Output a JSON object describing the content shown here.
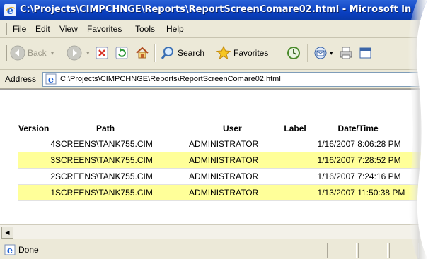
{
  "window": {
    "title": "C:\\Projects\\CIMPCHNGE\\Reports\\ReportScreenComare02.html - Microsoft In"
  },
  "menu": {
    "items": [
      "File",
      "Edit",
      "View",
      "Favorites",
      "Tools",
      "Help"
    ]
  },
  "toolbar": {
    "back_label": "Back",
    "search_label": "Search",
    "favorites_label": "Favorites"
  },
  "address": {
    "label": "Address",
    "value": "C:\\Projects\\CIMPCHNGE\\Reports\\ReportScreenComare02.html"
  },
  "report": {
    "columns": [
      "Version",
      "Path",
      "User",
      "Label",
      "Date/Time"
    ],
    "rows": [
      {
        "version": "4",
        "path": "SCREENS\\TANK755.CIM",
        "user": "ADMINISTRATOR",
        "label": "",
        "datetime": "1/16/2007 8:06:28 PM",
        "highlight": false
      },
      {
        "version": "3",
        "path": "SCREENS\\TANK755.CIM",
        "user": "ADMINISTRATOR",
        "label": "",
        "datetime": "1/16/2007 7:28:52 PM",
        "highlight": true
      },
      {
        "version": "2",
        "path": "SCREENS\\TANK755.CIM",
        "user": "ADMINISTRATOR",
        "label": "",
        "datetime": "1/16/2007 7:24:16 PM",
        "highlight": false
      },
      {
        "version": "1",
        "path": "SCREENS\\TANK755.CIM",
        "user": "ADMINISTRATOR",
        "label": "",
        "datetime": "1/13/2007 11:50:38 PM",
        "highlight": true
      }
    ],
    "highlight_color": "#ffff99"
  },
  "status": {
    "text": "Done"
  },
  "colors": {
    "titlebar": "#0a3fc0",
    "chrome": "#ece9d8"
  }
}
